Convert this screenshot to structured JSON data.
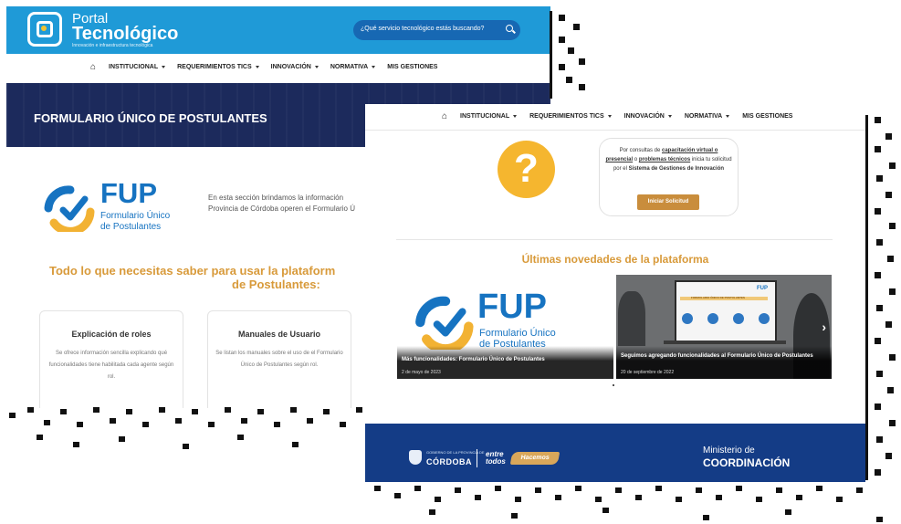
{
  "back": {
    "header": {
      "logo_title": "Portal",
      "logo_subtitle": "Tecnológico",
      "logo_tagline": "Innovación e infraestructura tecnológica",
      "search_placeholder": "¿Qué servicio tecnológico estás buscando?"
    },
    "nav": {
      "items": [
        {
          "label": "INSTITUCIONAL",
          "dropdown": true
        },
        {
          "label": "REQUERIMIENTOS TICS",
          "dropdown": true
        },
        {
          "label": "INNOVACIÓN",
          "dropdown": true
        },
        {
          "label": "NORMATIVA",
          "dropdown": true
        },
        {
          "label": "MIS GESTIONES",
          "dropdown": false
        }
      ]
    },
    "banner_title": "FORMULARIO ÚNICO DE POSTULANTES",
    "fup_logo": {
      "word": "FUP",
      "sub1": "Formulario Único",
      "sub2": "de Postulantes"
    },
    "intro_line1": "En esta sección brindamos la información",
    "intro_line2": "Provincia de Córdoba operen el Formulario Ú",
    "section_heading_line1": "Todo lo que necesitas saber para usar la plataform",
    "section_heading_line2": "de Postulantes:",
    "cards": [
      {
        "title": "Explicación de roles",
        "text": "Se ofrece información sencilla explicando qué funcionalidades tiene habilitada cada agente según rol."
      },
      {
        "title": "Manuales de Usuario",
        "text": "Se listan los manuales sobre el uso de el Formulario Único de Postulantes según rol."
      }
    ]
  },
  "front": {
    "nav": {
      "items": [
        {
          "label": "INSTITUCIONAL",
          "dropdown": true
        },
        {
          "label": "REQUERIMIENTOS TICS",
          "dropdown": true
        },
        {
          "label": "INNOVACIÓN",
          "dropdown": true
        },
        {
          "label": "NORMATIVA",
          "dropdown": true
        },
        {
          "label": "MIS GESTIONES",
          "dropdown": false
        }
      ]
    },
    "help": {
      "icon": "question-mark-icon",
      "text_prefix": "Por consultas de ",
      "link1": "capacitación virtual o presencial",
      "text_mid": " o ",
      "link2": "problemas técnicos",
      "text_mid2": " inicia tu solicitud por el ",
      "strong": "Sistema de Gestiones de Innovación",
      "button": "Iniciar Solicitud"
    },
    "news_heading": "Últimas novedades de la plataforma",
    "slides": [
      {
        "title": "Más funcionalidades: Formulario Único de Postulantes",
        "date": "2 de mayo de 2023"
      },
      {
        "title": "Seguimos agregando funcionalidades al Formulario Único de Postulantes",
        "date": "20 de septiembre de 2022"
      }
    ],
    "slide_fup": {
      "word": "FUP",
      "sub1": "Formulario Único",
      "sub2": "de Postulantes"
    },
    "mini_screen": {
      "logo": "FUP",
      "bar_text": "FORMULARIO ÚNICO DE POSTULANTES"
    },
    "footer": {
      "province_small": "GOBIERNO DE LA PROVINCIA DE",
      "province": "CÓRDOBA",
      "entre1": "entre",
      "entre2": "todos",
      "hacemos": "Hacemos",
      "ministry1": "Ministerio de",
      "ministry2": "COORDINACIÓN"
    }
  },
  "colors": {
    "header_blue": "#1f9ad7",
    "accent_gold": "#d89a3a",
    "brand_blue": "#1673c1",
    "footer_navy": "#143c86"
  }
}
